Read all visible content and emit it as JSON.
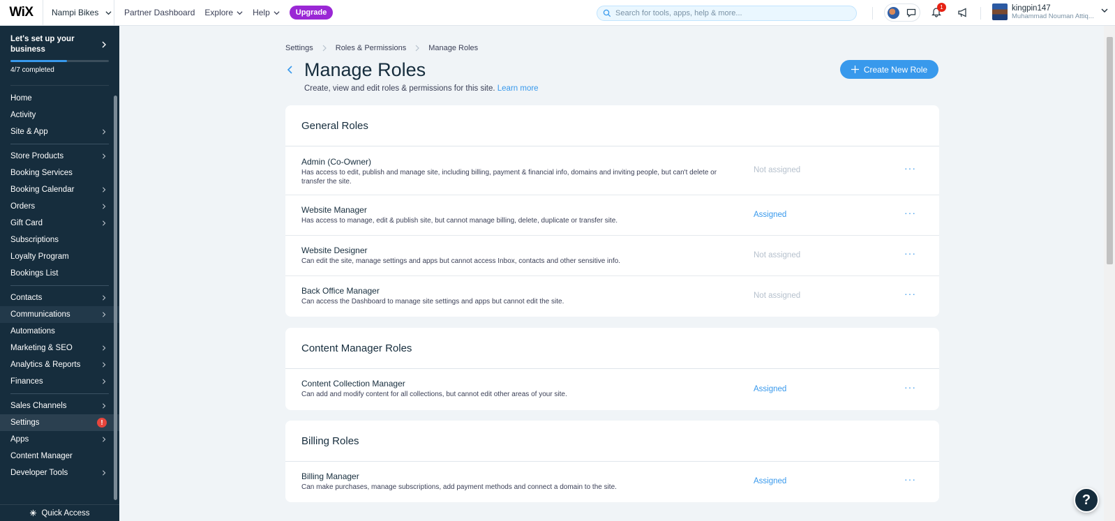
{
  "topbar": {
    "logo": "WiX",
    "site_name": "Nampi Bikes",
    "nav": [
      "Partner Dashboard",
      "Explore",
      "Help"
    ],
    "upgrade": "Upgrade",
    "search_placeholder": "Search for tools, apps, help & more...",
    "notification_count": "1",
    "user_name": "kingpin147",
    "user_full": "Muhammad Nouman Attiq..."
  },
  "sidebar": {
    "setup_title": "Let's set up your business",
    "setup_progress": "4/7 completed",
    "setup_fraction": 0.571,
    "groups": [
      [
        {
          "label": "Home",
          "chevron": false
        },
        {
          "label": "Activity",
          "chevron": false
        },
        {
          "label": "Site & App",
          "chevron": true
        }
      ],
      [
        {
          "label": "Store Products",
          "chevron": true
        },
        {
          "label": "Booking Services",
          "chevron": false
        },
        {
          "label": "Booking Calendar",
          "chevron": true
        },
        {
          "label": "Orders",
          "chevron": true
        },
        {
          "label": "Gift Card",
          "chevron": true
        },
        {
          "label": "Subscriptions",
          "chevron": false
        },
        {
          "label": "Loyalty Program",
          "chevron": false
        },
        {
          "label": "Bookings List",
          "chevron": false
        }
      ],
      [
        {
          "label": "Contacts",
          "chevron": true
        },
        {
          "label": "Communications",
          "chevron": true
        },
        {
          "label": "Automations",
          "chevron": false
        },
        {
          "label": "Marketing & SEO",
          "chevron": true
        },
        {
          "label": "Analytics & Reports",
          "chevron": true
        },
        {
          "label": "Finances",
          "chevron": true
        }
      ],
      [
        {
          "label": "Sales Channels",
          "chevron": true
        },
        {
          "label": "Settings",
          "chevron": false
        },
        {
          "label": "Apps",
          "chevron": true
        },
        {
          "label": "Content Manager",
          "chevron": false
        },
        {
          "label": "Developer Tools",
          "chevron": true
        }
      ]
    ],
    "settings_badge": "!",
    "quick_access": "Quick Access"
  },
  "main": {
    "breadcrumb": [
      "Settings",
      "Roles & Permissions",
      "Manage Roles"
    ],
    "title": "Manage Roles",
    "subtitle": "Create, view and edit roles & permissions for this site.",
    "learn_more": "Learn more",
    "create_button": "Create New Role",
    "sections": [
      {
        "title": "General Roles",
        "roles": [
          {
            "name": "Admin (Co-Owner)",
            "desc": "Has access to edit, publish and manage site, including billing, payment & financial info, domains and inviting people, but can't delete or transfer the site.",
            "status": "Not assigned",
            "assigned": false
          },
          {
            "name": "Website Manager",
            "desc": "Has access to manage, edit & publish site, but cannot manage billing, delete, duplicate or transfer site.",
            "status": "Assigned",
            "assigned": true
          },
          {
            "name": "Website Designer",
            "desc": "Can edit the site, manage settings and apps but cannot access Inbox, contacts and other sensitive info.",
            "status": "Not assigned",
            "assigned": false
          },
          {
            "name": "Back Office Manager",
            "desc": "Can access the Dashboard to manage site settings and apps but cannot edit the site.",
            "status": "Not assigned",
            "assigned": false
          }
        ]
      },
      {
        "title": "Content Manager Roles",
        "roles": [
          {
            "name": "Content Collection Manager",
            "desc": "Can add and modify content for all collections, but cannot edit other areas of your site.",
            "status": "Assigned",
            "assigned": true
          }
        ]
      },
      {
        "title": "Billing Roles",
        "roles": [
          {
            "name": "Billing Manager",
            "desc": "Can make purchases, manage subscriptions, add payment methods and connect a domain to the site.",
            "status": "Assigned",
            "assigned": true
          }
        ]
      }
    ]
  },
  "help_button": "?"
}
